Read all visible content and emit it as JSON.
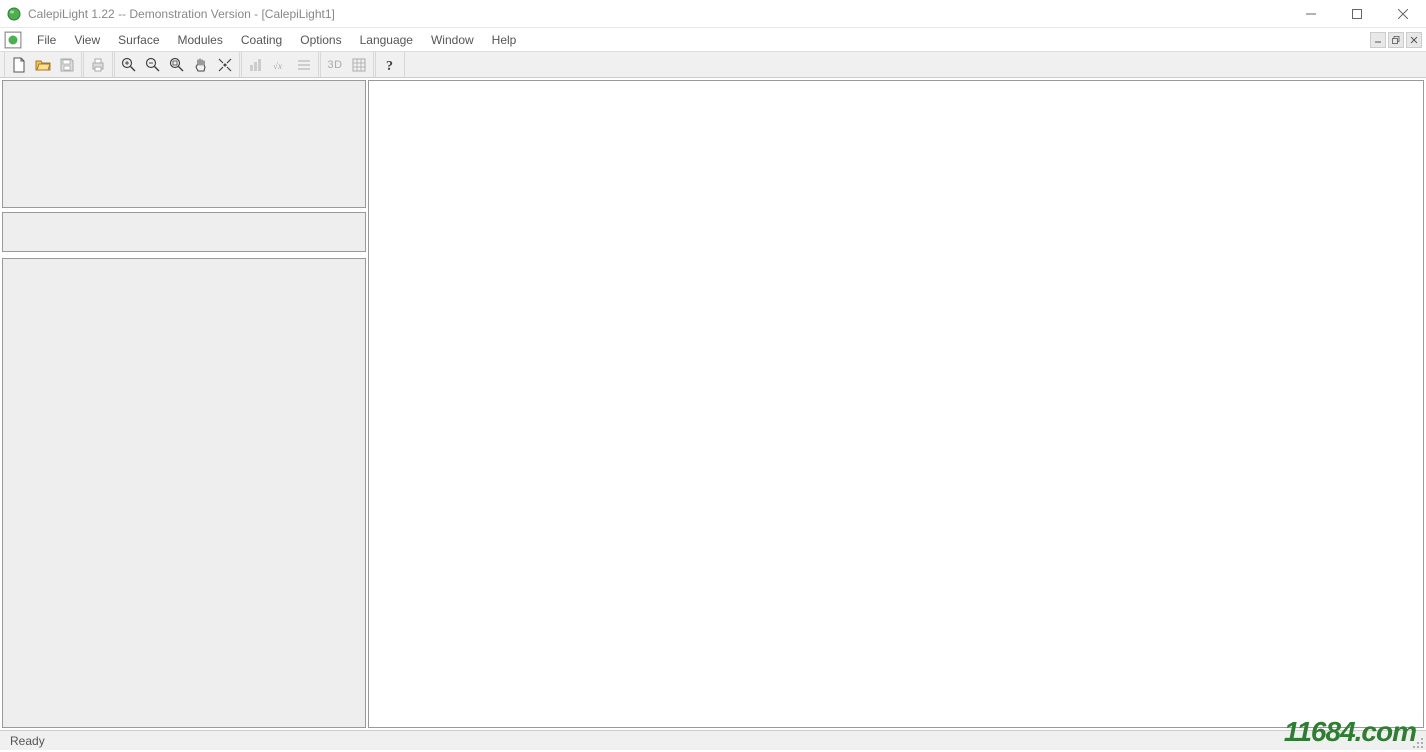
{
  "window": {
    "title": "CalepiLight 1.22 -- Demonstration Version - [CalepiLight1]"
  },
  "menu": {
    "items": [
      "File",
      "View",
      "Surface",
      "Modules",
      "Coating",
      "Options",
      "Language",
      "Window",
      "Help"
    ]
  },
  "toolbar": {
    "groups": [
      [
        "new-file",
        "open-file",
        "save-file"
      ],
      [
        "print"
      ],
      [
        "zoom-in",
        "zoom-out",
        "zoom-area",
        "pan",
        "fit-view"
      ],
      [
        "chart",
        "formula",
        "lines"
      ],
      [
        "3d",
        "grid"
      ],
      [
        "help"
      ]
    ],
    "label_3d": "3D"
  },
  "status": {
    "text": "Ready"
  },
  "watermark": {
    "text": "11684.com"
  }
}
